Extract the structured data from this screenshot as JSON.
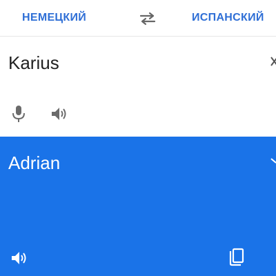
{
  "languages": {
    "source": "НЕМЕЦКИЙ",
    "target": "ИСПАНСКИЙ"
  },
  "input": {
    "text": "Karius"
  },
  "output": {
    "text": "Adrian"
  },
  "colors": {
    "accent": "#1a73e8",
    "language_label": "#2f6fd6",
    "icon_gray": "#707070",
    "output_text": "#ffffff"
  },
  "icons": {
    "swap": "swap-arrows-icon",
    "microphone": "microphone-icon",
    "source_speaker": "speaker-icon",
    "output_speaker": "speaker-icon",
    "copy": "copy-icon"
  }
}
